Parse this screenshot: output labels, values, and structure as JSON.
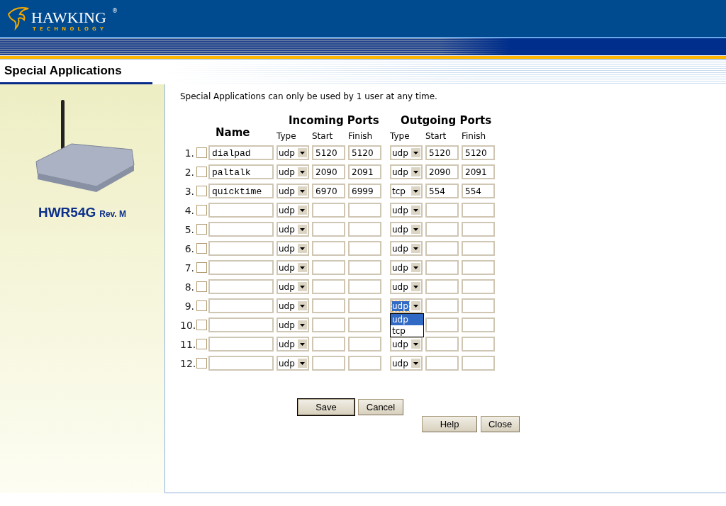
{
  "logo": {
    "name": "HAWKING",
    "mark": "®",
    "tagline": "TECHNOLOGY"
  },
  "page_title": "Special Applications",
  "product": {
    "model": "HWR54G",
    "revision": "Rev. M"
  },
  "note": "Special Applications can only be used by 1 user at any time.",
  "headers": {
    "name": "Name",
    "incoming": "Incoming Ports",
    "outgoing": "Outgoing Ports",
    "columns": [
      "Type",
      "Start",
      "Finish",
      "Type",
      "Start",
      "Finish"
    ]
  },
  "rows": [
    {
      "index": "1.",
      "checked": false,
      "name": "dialpad",
      "in_type": "udp",
      "in_start": "5120",
      "in_finish": "5120",
      "out_type": "udp",
      "out_start": "5120",
      "out_finish": "5120",
      "open": false
    },
    {
      "index": "2.",
      "checked": false,
      "name": "paltalk",
      "in_type": "udp",
      "in_start": "2090",
      "in_finish": "2091",
      "out_type": "udp",
      "out_start": "2090",
      "out_finish": "2091",
      "open": false
    },
    {
      "index": "3.",
      "checked": false,
      "name": "quicktime",
      "in_type": "udp",
      "in_start": "6970",
      "in_finish": "6999",
      "out_type": "tcp",
      "out_start": "554",
      "out_finish": "554",
      "open": false
    },
    {
      "index": "4.",
      "checked": false,
      "in_type": "udp",
      "out_type": "udp",
      "open": false
    },
    {
      "index": "5.",
      "checked": false,
      "in_type": "udp",
      "out_type": "udp",
      "open": false
    },
    {
      "index": "6.",
      "checked": false,
      "in_type": "udp",
      "out_type": "udp",
      "open": false
    },
    {
      "index": "7.",
      "checked": false,
      "in_type": "udp",
      "out_type": "udp",
      "open": false
    },
    {
      "index": "8.",
      "checked": false,
      "in_type": "udp",
      "out_type": "udp",
      "open": false
    },
    {
      "index": "9.",
      "checked": false,
      "in_type": "udp",
      "out_type": "udp",
      "open": true,
      "options": [
        {
          "label": "udp",
          "selected": true
        },
        {
          "label": "tcp",
          "selected": false
        }
      ]
    },
    {
      "index": "10.",
      "checked": false,
      "in_type": "udp",
      "open": false
    },
    {
      "index": "11.",
      "checked": false,
      "in_type": "udp",
      "out_type": "udp",
      "open": false
    },
    {
      "index": "12.",
      "checked": false,
      "in_type": "udp",
      "out_type": "udp",
      "open": false
    }
  ],
  "buttons": [
    {
      "label": "Save",
      "default": true
    },
    {
      "label": "Cancel",
      "default": false
    }
  ],
  "footer_buttons": [
    "Help",
    "Close"
  ]
}
